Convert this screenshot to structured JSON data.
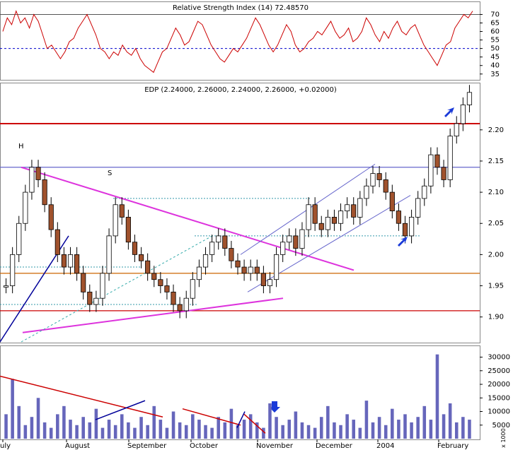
{
  "rsi_panel": {
    "title": "Relative Strength Index (14) 72.48570"
  },
  "price_panel": {
    "title": "EDP (2.24000, 2.26000, 2.24000, 2.26000, +0.02000)",
    "annotations": [
      "H",
      "S"
    ]
  },
  "volume_panel": {
    "scale_label": "x 1000"
  },
  "x_labels": [
    "uly",
    "August",
    "September",
    "October",
    "November",
    "December",
    "2004",
    "February"
  ],
  "chart_data": [
    {
      "type": "line",
      "panel": "rsi",
      "title": "Relative Strength Index (14) 72.48570",
      "ylim": [
        32,
        76
      ],
      "yticks": [
        35,
        40,
        45,
        50,
        55,
        60,
        65,
        70
      ],
      "reference_lines": [
        70,
        50
      ],
      "series": [
        {
          "name": "Relative Strength Index (14)",
          "color": "#cc0000",
          "values": [
            60,
            68,
            64,
            72,
            65,
            68,
            62,
            70,
            66,
            58,
            50,
            52,
            48,
            44,
            48,
            54,
            56,
            62,
            66,
            70,
            64,
            58,
            50,
            48,
            44,
            48,
            46,
            52,
            48,
            46,
            50,
            44,
            40,
            38,
            36,
            42,
            48,
            50,
            56,
            62,
            58,
            52,
            54,
            60,
            66,
            64,
            58,
            52,
            48,
            44,
            42,
            46,
            50,
            48,
            52,
            56,
            62,
            68,
            64,
            58,
            52,
            48,
            52,
            58,
            64,
            60,
            52,
            48,
            50,
            54,
            56,
            60,
            58,
            62,
            66,
            60,
            56,
            58,
            62,
            54,
            56,
            60,
            68,
            64,
            58,
            54,
            60,
            56,
            62,
            66,
            60,
            58,
            62,
            64,
            58,
            52,
            48,
            44,
            40,
            46,
            52,
            54,
            62,
            66,
            70,
            68,
            72
          ]
        }
      ]
    },
    {
      "type": "candlestick",
      "panel": "price",
      "title": "EDP (2.24000, 2.26000, 2.24000, 2.26000, +0.02000)",
      "ylim": [
        1.86,
        2.27
      ],
      "yticks": [
        1.9,
        1.95,
        2.0,
        2.05,
        2.1,
        2.15,
        2.2
      ],
      "last": {
        "open": 2.24,
        "high": 2.26,
        "low": 2.24,
        "close": 2.26,
        "change": 0.02
      },
      "x": [
        "uly",
        "August",
        "September",
        "October",
        "November",
        "December",
        "2004",
        "February"
      ],
      "closes": [
        1.95,
        2.0,
        2.05,
        2.1,
        2.14,
        2.12,
        2.08,
        2.04,
        2.0,
        1.98,
        2.0,
        1.97,
        1.94,
        1.92,
        1.93,
        1.97,
        2.03,
        2.08,
        2.06,
        2.02,
        2.0,
        1.99,
        1.97,
        1.96,
        1.95,
        1.94,
        1.92,
        1.91,
        1.93,
        1.96,
        1.98,
        2.0,
        2.02,
        2.03,
        2.01,
        1.99,
        1.98,
        1.97,
        1.98,
        1.97,
        1.95,
        1.96,
        2.0,
        2.02,
        2.03,
        2.01,
        2.04,
        2.08,
        2.05,
        2.04,
        2.06,
        2.05,
        2.07,
        2.08,
        2.06,
        2.09,
        2.11,
        2.13,
        2.12,
        2.1,
        2.07,
        2.05,
        2.03,
        2.06,
        2.09,
        2.11,
        2.16,
        2.14,
        2.12,
        2.19,
        2.21,
        2.24,
        2.26
      ],
      "horizontal_lines": [
        {
          "value": 2.21,
          "color": "#cc0000"
        },
        {
          "value": 2.14,
          "color": "#6666cc"
        },
        {
          "value": 1.91,
          "color": "#cc0000"
        },
        {
          "value": 1.97,
          "color": "#cc6600"
        }
      ]
    },
    {
      "type": "bar",
      "panel": "volume",
      "ylim": [
        0,
        33000
      ],
      "yticks": [
        5000,
        10000,
        15000,
        20000,
        25000,
        30000
      ],
      "yticklabels": [
        "5000",
        "10000",
        "15000",
        "20000",
        "25000",
        "30000"
      ],
      "values": [
        9000,
        22000,
        12000,
        5000,
        8000,
        15000,
        6000,
        4000,
        9000,
        12000,
        7000,
        5000,
        8000,
        6000,
        11000,
        4000,
        7000,
        5000,
        9000,
        6000,
        4000,
        8000,
        5000,
        12000,
        7000,
        4000,
        10000,
        6000,
        5000,
        9000,
        7000,
        5000,
        4000,
        8000,
        6000,
        11000,
        5000,
        7000,
        9000,
        6000,
        4000,
        13000,
        8000,
        5000,
        7000,
        10000,
        6000,
        5000,
        4000,
        8000,
        12000,
        6000,
        5000,
        9000,
        7000,
        4000,
        14000,
        6000,
        8000,
        5000,
        11000,
        7000,
        9000,
        6000,
        8000,
        12000,
        7000,
        31000,
        9000,
        13000,
        6000,
        8000,
        7000
      ]
    }
  ]
}
